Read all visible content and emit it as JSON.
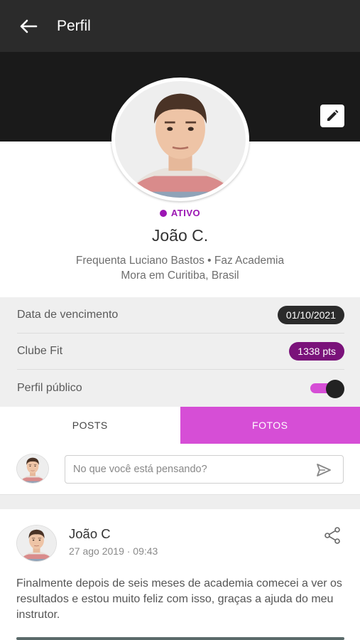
{
  "header": {
    "title": "Perfil",
    "back_icon": "arrow-left-icon"
  },
  "profile": {
    "edit_icon": "pencil-icon",
    "status": "ATIVO",
    "name": "João C.",
    "line1": "Frequenta Luciano Bastos • Faz Academia",
    "line2": "Mora em Curitiba, Brasil"
  },
  "info": {
    "due_label": "Data de vencimento",
    "due_value": "01/10/2021",
    "club_label": "Clube Fit",
    "club_value": "1338 pts",
    "public_label": "Perfil público",
    "public_on": true
  },
  "tabs": [
    {
      "label": "POSTS",
      "active": false
    },
    {
      "label": "FOTOS",
      "active": true
    }
  ],
  "composer": {
    "placeholder": "No que você está pensando?",
    "send_icon": "send-icon"
  },
  "post": {
    "author": "João C",
    "time": "27 ago 2019 · 09:43",
    "share_icon": "share-icon",
    "text": "Finalmente depois de seis meses de academia comecei a ver os resultados e estou muito feliz com isso, graças a ajuda do meu instrutor."
  },
  "colors": {
    "accent": "#d64ed6",
    "status": "#9b16b3",
    "points": "#7a127a",
    "dark": "#2b2b2b"
  }
}
